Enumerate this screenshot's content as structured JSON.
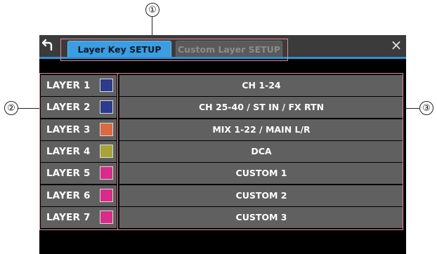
{
  "callouts": [
    "①",
    "②",
    "③"
  ],
  "dialog": {
    "tabs": [
      {
        "label": "Layer Key SETUP",
        "active": true
      },
      {
        "label": "Custom Layer SETUP",
        "active": false
      }
    ],
    "back_icon": "back-arrow-icon",
    "close_icon": "close-icon",
    "close_glyph": "×"
  },
  "layers": [
    {
      "name": "LAYER 1",
      "color": "#2e3a8c",
      "assignment": "CH 1-24"
    },
    {
      "name": "LAYER 2",
      "color": "#2e3a8c",
      "assignment": "CH 25-40 / ST IN / FX RTN"
    },
    {
      "name": "LAYER 3",
      "color": "#d96a42",
      "assignment": "MIX 1-22 / MAIN L/R"
    },
    {
      "name": "LAYER 4",
      "color": "#a9a43a",
      "assignment": "DCA"
    },
    {
      "name": "LAYER 5",
      "color": "#d92b8a",
      "assignment": "CUSTOM 1"
    },
    {
      "name": "LAYER 6",
      "color": "#d92b8a",
      "assignment": "CUSTOM 2"
    },
    {
      "name": "LAYER 7",
      "color": "#d92b8a",
      "assignment": "CUSTOM 3"
    }
  ],
  "colors": {
    "accent": "#3c9de0",
    "highlight": "#e48a9b",
    "button_bg": "#606060"
  }
}
